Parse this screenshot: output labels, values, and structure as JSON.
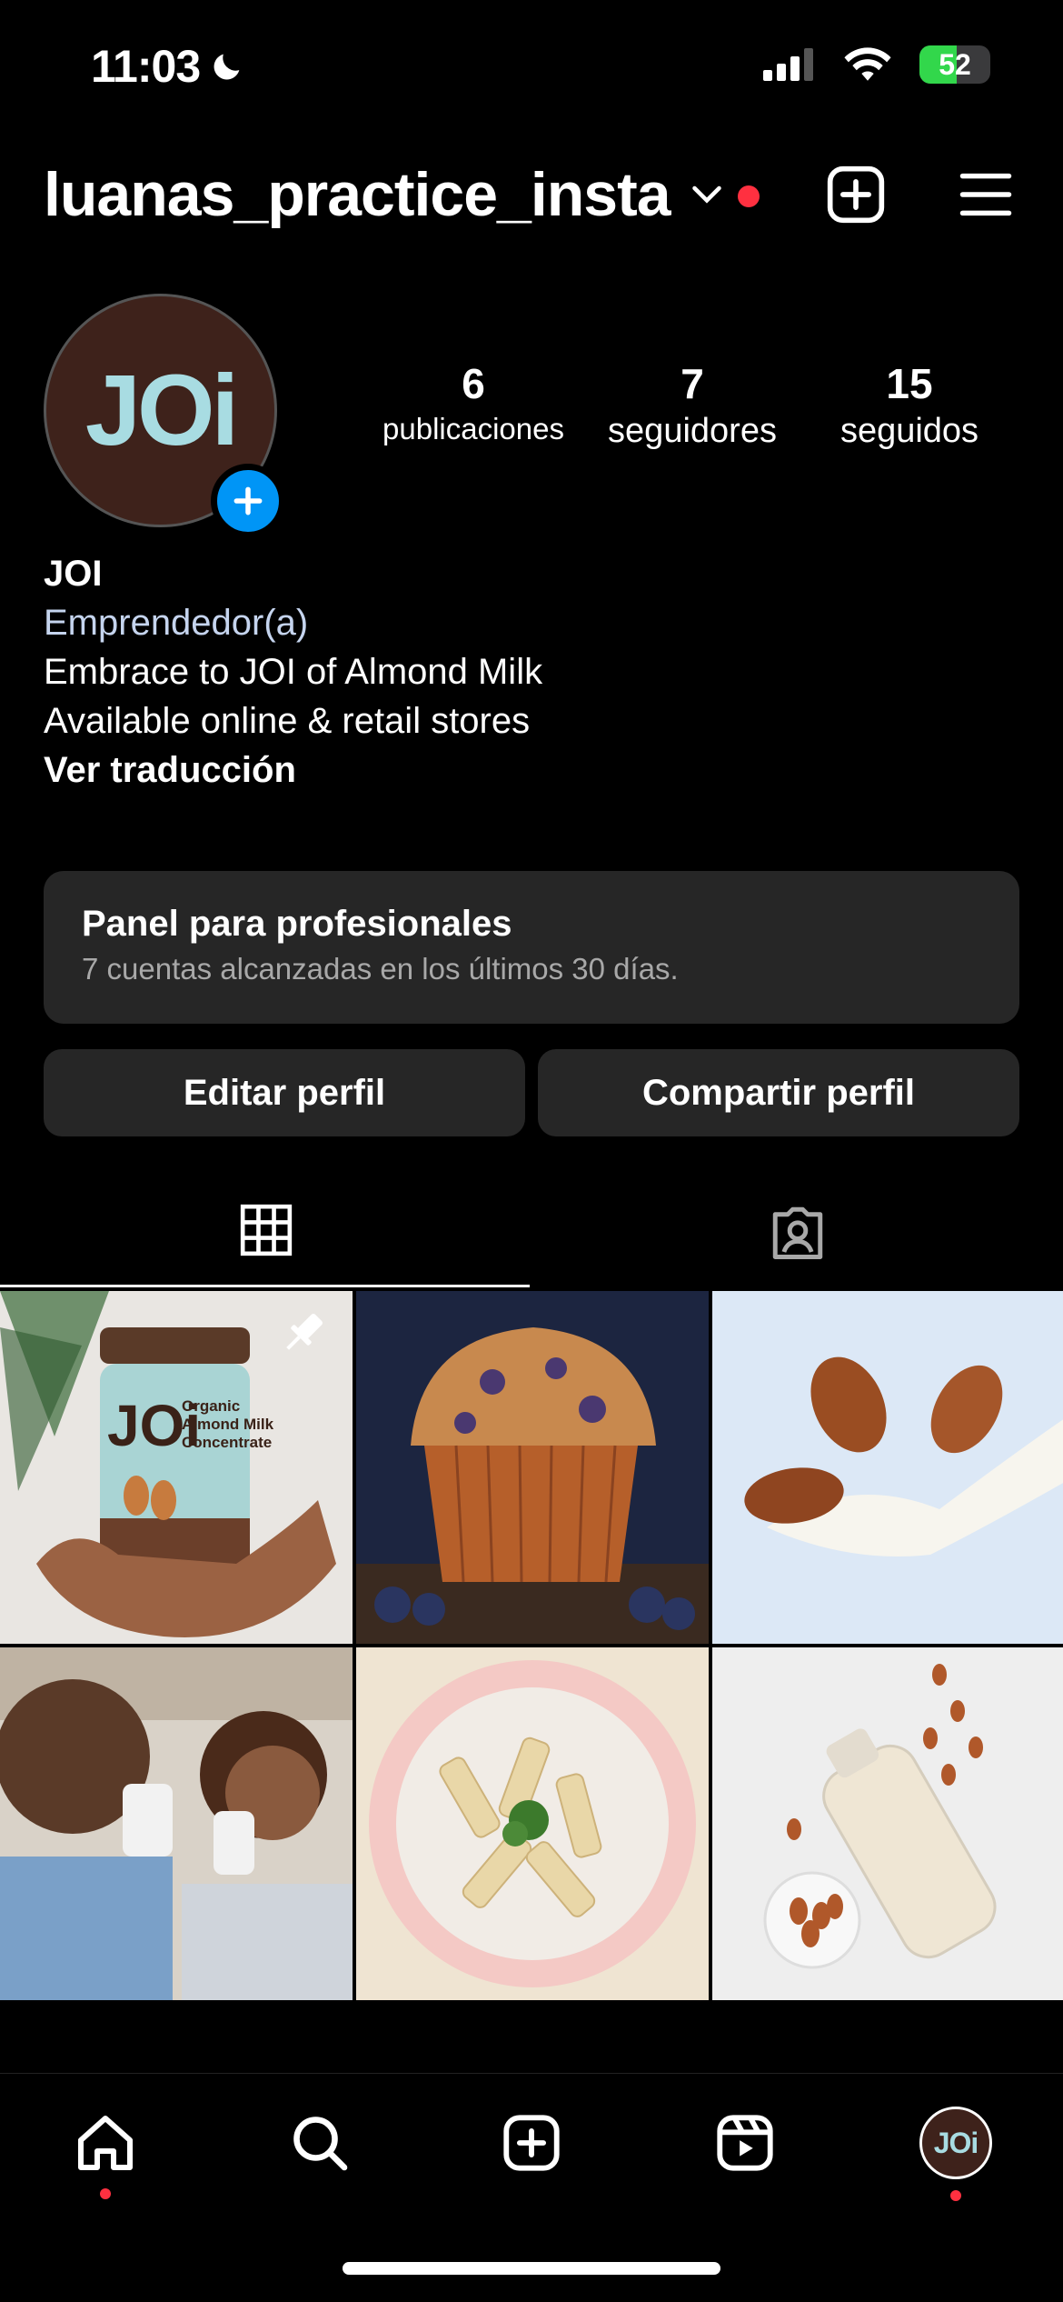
{
  "status_bar": {
    "time": "11:03",
    "battery_percent": "52",
    "battery_level": 0.52,
    "icons": [
      "moon-icon",
      "cellular-signal-icon",
      "wifi-icon",
      "battery-charging-icon"
    ]
  },
  "header": {
    "username": "luanas_practice_insta",
    "icons": [
      "chevron-down-icon",
      "new-post-icon",
      "menu-icon"
    ],
    "notification_color": "#ff3040"
  },
  "profile": {
    "avatar_text": "JOi",
    "stats": [
      {
        "value": "6",
        "label": "publicaciones"
      },
      {
        "value": "7",
        "label": "seguidores"
      },
      {
        "value": "15",
        "label": "seguidos"
      }
    ],
    "name": "JOI",
    "category": "Emprendedor(a)",
    "bio_line1": "Embrace to JOI of Almond Milk",
    "bio_line2": "Available online & retail stores",
    "translate_link": "Ver traducción"
  },
  "professional_panel": {
    "title": "Panel para profesionales",
    "subtitle": "7 cuentas alcanzadas en los últimos 30 días."
  },
  "actions": {
    "edit_profile": "Editar perfil",
    "share_profile": "Compartir perfil"
  },
  "tabs": [
    "grid-tab",
    "tagged-tab"
  ],
  "posts": [
    {
      "subject": "JOi Organic Almond Milk Concentrate jar held in hands",
      "label": "Organic Almond Milk Concentrate",
      "pinned": true
    },
    {
      "subject": "Blueberry muffin",
      "pinned": false
    },
    {
      "subject": "Almonds splashing in milk",
      "pinned": false
    },
    {
      "subject": "Father and daughter drinking milk",
      "pinned": false
    },
    {
      "subject": "Creamy penne pasta plate",
      "pinned": false
    },
    {
      "subject": "Almond milk bottle with almonds",
      "pinned": false
    }
  ],
  "bottom_nav": [
    "home-icon",
    "search-icon",
    "create-icon",
    "reels-icon",
    "profile-avatar"
  ],
  "colors": {
    "accent_blue": "#0095f6",
    "surface": "#262626",
    "avatar_bg": "#3e221b",
    "avatar_text": "#a8dce2"
  }
}
